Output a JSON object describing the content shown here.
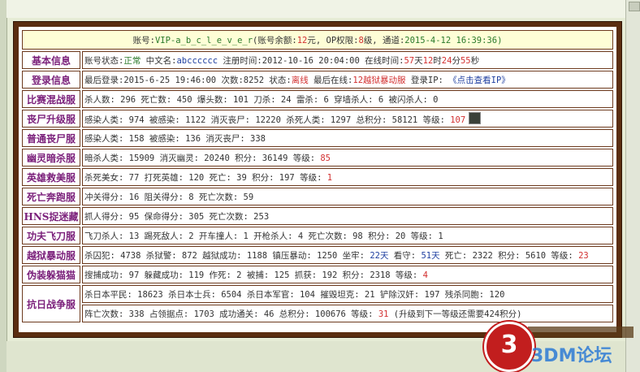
{
  "header": {
    "account_label": "账号:",
    "account_value": "VIP-a_b_c_l_e_v_e_r",
    "balance_label": "(账号余额:",
    "balance_value": "12",
    "balance_unit": "元, ",
    "op_label": "OP权限:",
    "op_value": "8",
    "op_unit": "级, 通道:",
    "datetime": "2015-4-12 16:39:36)"
  },
  "rows": {
    "basic": {
      "label": "基本信息",
      "status_label": "账号状态:",
      "status_value": "正常",
      "cn_label": " 中文名:",
      "cn_value": "abcccccc",
      "reg_label": " 注册时间:",
      "reg_value": "2012-10-16 20:04:00",
      "online_label": " 在线时间:",
      "days": "57",
      "days_unit": "天",
      "hours": "12",
      "hours_unit": "时",
      "minutes": "24",
      "minutes_unit": "分",
      "seconds": "55",
      "seconds_unit": "秒"
    },
    "login": {
      "label": "登录信息",
      "last_label": "最后登录:",
      "last_value": "2015-6-25 19:46:00",
      "count_label": " 次数:",
      "count_value": "8252",
      "state_label": " 状态:",
      "state_value": "离线",
      "lastonline_label": " 最后在线:",
      "lastonline_value": "12越狱暴动服",
      "ip_label": " 登录IP: ",
      "ip_link": "《点击查看IP》"
    },
    "race": {
      "label": "比赛混战服",
      "text": "杀人数: 296 死亡数: 450 爆头数: 101 刀杀: 24 雷杀: 6 穿墙杀人: 6 被闪杀人: 0"
    },
    "zombie_up": {
      "label": "丧尸升级服",
      "text": "感染人类: 974 被感染: 1122 消灭丧尸: 12220 杀死人类: 1297 总积分: 58121 等级: ",
      "level": "107"
    },
    "zombie_normal": {
      "label": "普通丧尸服",
      "text": "感染人类: 158 被感染: 136 消灭丧尸: 338"
    },
    "ghost": {
      "label": "幽灵暗杀服",
      "text": "暗杀人类: 15909 消灭幽灵: 20240 积分: 36149 等级: ",
      "level": "85"
    },
    "hero": {
      "label": "英雄救美服",
      "text": "杀死美女: 77 打死英雄: 120 死亡: 39 积分: 197 等级: ",
      "level": "1"
    },
    "escape": {
      "label": "死亡奔跑服",
      "text": "冲关得分: 16 阻关得分: 8 死亡次数: 59"
    },
    "hns": {
      "label": "HNS捉迷藏",
      "text": "抓人得分: 95 保命得分: 305 死亡次数: 253"
    },
    "kungfu": {
      "label": "功夫飞刀服",
      "text": "飞刀杀人: 13 踢死敌人: 2 开车撞人: 1 开枪杀人: 4 死亡次数: 98 积分: 20 等级: 1"
    },
    "jail": {
      "label": "越狱暴动服",
      "pre": "杀囚犯: 4738 杀狱警: 872 越狱成功: 1188 镇压暴动: 1250 坐牢: ",
      "jail_days": "22天",
      "mid": " 看守: ",
      "guard_days": "51天",
      "post": " 死亡: 2322 积分: 5610 等级: ",
      "level": "23"
    },
    "hide": {
      "label": "伪装躲猫猫",
      "text": "搜捕成功: 97 躲藏成功: 119 作死: 2 被捕: 125 抓获: 192 积分: 2318 等级: ",
      "level": "4"
    },
    "war": {
      "label": "抗日战争服",
      "line1": "杀日本平民: 18623 杀日本士兵: 6504 杀日本军官: 104 摧毁坦克: 21 铲除汉奸: 197 残杀同胞: 120",
      "line2_pre": "阵亡次数: 338 占领据点: 1703 成功通关: 46 总积分: 100676 等级: ",
      "level": "31",
      "line2_post": " (升级到下一等级还需要424积分)"
    }
  },
  "watermark": {
    "logo_char": "3",
    "text": "3DM论坛"
  }
}
